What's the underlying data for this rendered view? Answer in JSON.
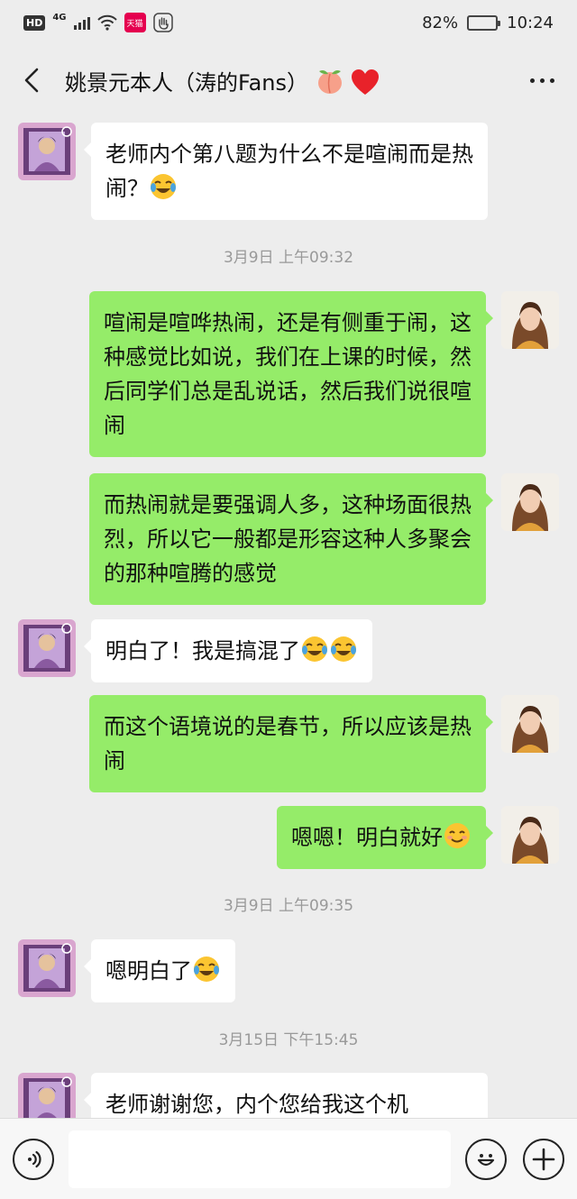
{
  "status_bar": {
    "hd": "HD",
    "network": "4G",
    "tmall": "天猫",
    "battery": "82%",
    "battery_level": 0.82,
    "time": "10:24"
  },
  "header": {
    "title": "姚景元本人（涛的Fans）",
    "title_emojis": [
      "peach-emoji",
      "red-heart-emoji"
    ]
  },
  "timestamps": [
    "3月9日 上午09:32",
    "3月9日 上午09:35",
    "3月15日 下午15:45"
  ],
  "messages": [
    {
      "side": "in",
      "text": "老师内个第八题为什么不是喧闹而是热闹？",
      "emoji": "tears-of-joy"
    },
    {
      "side": "out",
      "text": "喧闹是喧哗热闹，还是有侧重于闹，这种感觉比如说，我们在上课的时候，然后同学们总是乱说话，然后我们说很喧闹"
    },
    {
      "side": "out",
      "text": "而热闹就是要强调人多，这种场面很热烈，所以它一般都是形容这种人多聚会的那种喧腾的感觉"
    },
    {
      "side": "in",
      "text": "明白了！我是搞混了",
      "emoji": "tears-of-joy x2"
    },
    {
      "side": "out",
      "text": "而这个语境说的是春节，所以应该是热闹"
    },
    {
      "side": "out",
      "text": "嗯嗯！明白就好",
      "emoji": "smiling-blush"
    },
    {
      "side": "in",
      "text": "嗯明白了",
      "emoji": "tears-of-joy"
    },
    {
      "side": "in",
      "text": "老师谢谢您，内个您给我这个机"
    }
  ],
  "input_bar": {
    "voice_icon": "voice-icon",
    "emoji_icon": "emoji-face-icon",
    "plus_icon": "plus-icon"
  },
  "colors": {
    "background": "#ededed",
    "outgoing_bubble": "#95ec69",
    "incoming_bubble": "#ffffff"
  }
}
